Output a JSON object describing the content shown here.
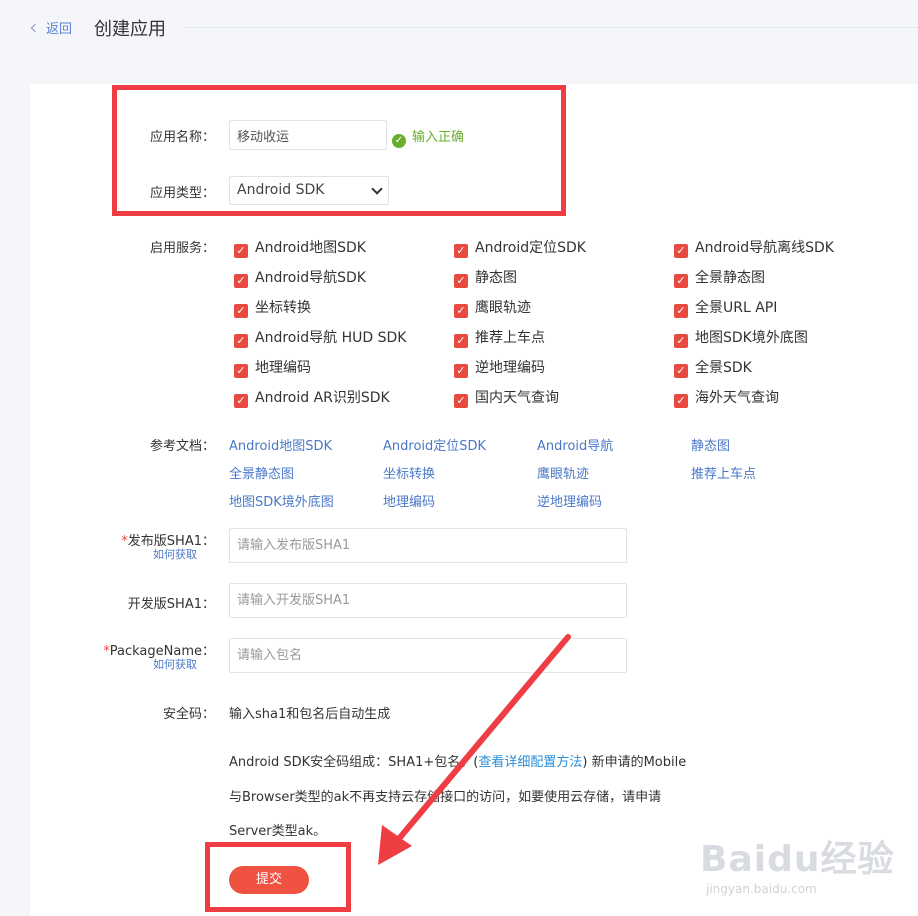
{
  "header": {
    "back": "返回",
    "title": "创建应用"
  },
  "form": {
    "app_name": {
      "label": "应用名称：",
      "value": "移动收运",
      "valid_text": "输入正确"
    },
    "app_type": {
      "label": "应用类型：",
      "value": "Android SDK"
    },
    "services": {
      "label": "启用服务：",
      "items": [
        "Android地图SDK",
        "Android定位SDK",
        "Android导航离线SDK",
        "Android导航SDK",
        "静态图",
        "全景静态图",
        "坐标转换",
        "鹰眼轨迹",
        "全景URL API",
        "Android导航 HUD SDK",
        "推荐上车点",
        "地图SDK境外底图",
        "地理编码",
        "逆地理编码",
        "全景SDK",
        "Android AR识别SDK",
        "国内天气查询",
        "海外天气查询"
      ]
    },
    "docs": {
      "label": "参考文档：",
      "links": [
        "Android地图SDK",
        "Android定位SDK",
        "Android导航",
        "静态图",
        "全景静态图",
        "坐标转换",
        "鹰眼轨迹",
        "推荐上车点",
        "地图SDK境外底图",
        "地理编码",
        "逆地理编码"
      ]
    },
    "release_sha1": {
      "required": "*",
      "label": "发布版SHA1：",
      "help": "如何获取",
      "placeholder": "请输入发布版SHA1"
    },
    "dev_sha1": {
      "label": "开发版SHA1：",
      "placeholder": "请输入开发版SHA1"
    },
    "package_name": {
      "required": "*",
      "label": "PackageName：",
      "help": "如何获取",
      "placeholder": "请输入包名"
    },
    "security_code": {
      "label": "安全码：",
      "value": "输入sha1和包名后自动生成"
    },
    "note": {
      "line1_before": "Android SDK安全码组成：SHA1+包名。(",
      "line1_link": "查看详细配置方法",
      "line1_after": ") 新申请的Mobile",
      "line2": "与Browser类型的ak不再支持云存储接口的访问，如要使用云存储，请申请",
      "line3": "Server类型ak。"
    },
    "submit": "提交"
  },
  "watermark": {
    "logo": "Baidu经验",
    "url": "jingyan.baidu.com"
  },
  "colors": {
    "accent": "#ef5241",
    "checkbox": "#e84a3f",
    "link": "#4a78c8",
    "valid": "#6aad2e",
    "annotation": "#ef3d44"
  }
}
